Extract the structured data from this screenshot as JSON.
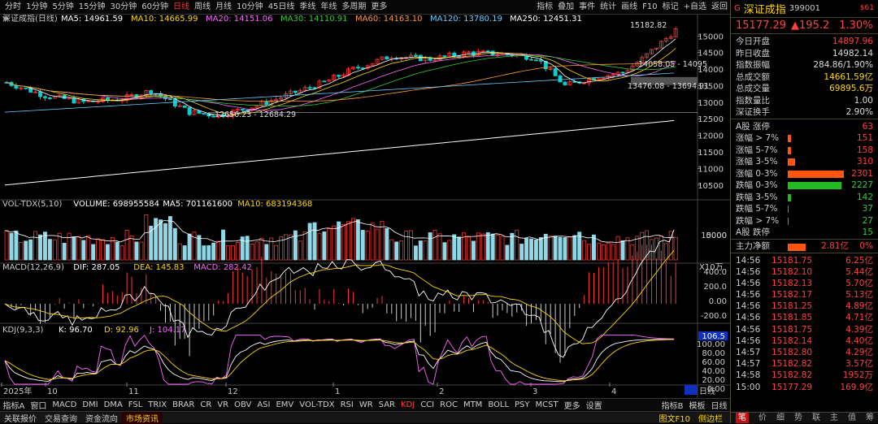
{
  "periods": [
    "分时",
    "1分钟",
    "5分钟",
    "15分钟",
    "30分钟",
    "60分钟",
    "日线",
    "周线",
    "月线",
    "10分钟",
    "45日线",
    "季线",
    "年线",
    "多周期",
    "更多"
  ],
  "active_period": "日线",
  "toolbar_right": [
    "指标",
    "叠加",
    "事件",
    "统计",
    "画线",
    "F10",
    "标记",
    "+自选",
    "返回"
  ],
  "ma_legend": {
    "title": "深证成指(日线)",
    "items": [
      {
        "t": "MA5: 14961.59",
        "c": "#ffffff"
      },
      {
        "t": "MA10: 14665.99",
        "c": "#ffd700"
      },
      {
        "t": "MA20: 14151.06",
        "c": "#ff66ff"
      },
      {
        "t": "MA30: 14110.91",
        "c": "#33cc33"
      },
      {
        "t": "MA60: 14163.10",
        "c": "#ff9933"
      },
      {
        "t": "MA120: 13780.19",
        "c": "#66ccff"
      },
      {
        "t": "MA250: 12451.31",
        "c": "#ffffff"
      }
    ]
  },
  "vol_legend": {
    "title": "VOL-TDX(5,10)",
    "items": [
      {
        "t": "VOLUME: 698955584",
        "c": "#ffffff"
      },
      {
        "t": "MA5: 701161600",
        "c": "#ffffff"
      },
      {
        "t": "MA10: 683194368",
        "c": "#ffd700"
      }
    ]
  },
  "macd_legend": {
    "title": "MACD(12,26,9)",
    "items": [
      {
        "t": "DIF: 287.05",
        "c": "#ffffff"
      },
      {
        "t": "DEA: 145.83",
        "c": "#ffd700"
      },
      {
        "t": "MACD: 282.42",
        "c": "#ff66ff"
      }
    ]
  },
  "kdj_legend": {
    "title": "KDJ(9,3,3)",
    "items": [
      {
        "t": "K: 96.70",
        "c": "#ffffff"
      },
      {
        "t": "D: 92.96",
        "c": "#ffd700"
      },
      {
        "t": "J: 104.17",
        "c": "#ff66ff"
      }
    ]
  },
  "price_axis": [
    "15000",
    "14500",
    "14000",
    "13500",
    "13000",
    "12500",
    "12000",
    "11500",
    "11000",
    "10500"
  ],
  "vol_axis": [
    "10000",
    "5000"
  ],
  "vol_unit": "X10万",
  "macd_axis": [
    "400.0",
    "200.0",
    "0.00",
    "-200.0"
  ],
  "kdj_axis": [
    "106.5",
    "100.00",
    "80.00",
    "60.00",
    "40.00",
    "20.00",
    "0.00"
  ],
  "annotations": {
    "high": "15182.82",
    "low1": "12684.29",
    "low1b": "12656.23",
    "low1c": "12564.92",
    "mid": "14058.05 - 14095",
    "low2": "13476.08 - 13694.91"
  },
  "date_labels": [
    "2025年",
    "10",
    "11",
    "12",
    "1",
    "2",
    "3",
    "4"
  ],
  "chart_data": {
    "type": "candlestick",
    "title": "深证成指(日线)",
    "y_range": [
      10200,
      15400
    ],
    "last_close": 15177.29,
    "high": 15182.82,
    "moving_averages": {
      "MA5": 14961.59,
      "MA10": 14665.99,
      "MA20": 14151.06,
      "MA30": 14110.91,
      "MA60": 14163.1,
      "MA120": 13780.19,
      "MA250": 12451.31
    },
    "volume": 698955584,
    "vol_ma5": 701161600,
    "vol_ma10": 683194368,
    "macd": {
      "DIF": 287.05,
      "DEA": 145.83,
      "MACD": 282.42
    },
    "kdj": {
      "K": 96.7,
      "D": 92.96,
      "J": 104.17
    }
  },
  "quote": {
    "name": "深证成指",
    "code": "399001",
    "badge": "$61",
    "price": "15177.29",
    "change": "▲195.2",
    "pct": "1.30%"
  },
  "stats": [
    {
      "l": "今日开盘",
      "v": "14897.96",
      "c": "red"
    },
    {
      "l": "昨日收盘",
      "v": "14982.14",
      "c": "wht"
    },
    {
      "l": "指数振幅",
      "v": "284.86/1.90%",
      "c": "wht"
    },
    {
      "l": "总成交额",
      "v": "14661.59亿",
      "c": "yel"
    },
    {
      "l": "总成交量",
      "v": "69895.6万",
      "c": "yel"
    },
    {
      "l": "指数量比",
      "v": "1.00",
      "c": "wht"
    },
    {
      "l": "深证换手",
      "v": "2.90%",
      "c": "wht"
    }
  ],
  "breadth": [
    {
      "l": "A股 涨停",
      "v": "63",
      "c": "red",
      "w": 0
    },
    {
      "l": "涨幅 > 7%",
      "v": "151",
      "c": "red",
      "w": 3
    },
    {
      "l": "涨幅 5-7%",
      "v": "158",
      "c": "red",
      "w": 3
    },
    {
      "l": "涨幅 3-5%",
      "v": "310",
      "c": "red",
      "w": 7
    },
    {
      "l": "涨幅 0-3%",
      "v": "2301",
      "c": "red",
      "w": 53
    },
    {
      "l": "跌幅 0-3%",
      "v": "2227",
      "c": "grn",
      "w": 51
    },
    {
      "l": "跌幅 3-5%",
      "v": "142",
      "c": "grn",
      "w": 3
    },
    {
      "l": "跌幅 5-7%",
      "v": "37",
      "c": "grn",
      "w": 1
    },
    {
      "l": "跌幅 > 7%",
      "v": "27",
      "c": "grn",
      "w": 1
    },
    {
      "l": "A股 跌停",
      "v": "15",
      "c": "grn",
      "w": 0
    }
  ],
  "net_flow": {
    "l": "主力净额",
    "v": "2.81亿",
    "pct": "0%"
  },
  "ticks": [
    [
      "14:56",
      "15181.75",
      "6.25亿"
    ],
    [
      "14:56",
      "15182.10",
      "5.44亿"
    ],
    [
      "14:56",
      "15182.13",
      "5.70亿"
    ],
    [
      "14:56",
      "15182.17",
      "5.13亿"
    ],
    [
      "14:56",
      "15181.25",
      "4.89亿"
    ],
    [
      "14:56",
      "15181.85",
      "4.71亿"
    ],
    [
      "14:56",
      "15181.75",
      "4.39亿"
    ],
    [
      "14:56",
      "15182.14",
      "4.40亿"
    ],
    [
      "14:57",
      "15182.80",
      "4.29亿"
    ],
    [
      "14:57",
      "15182.82",
      "3.57亿"
    ],
    [
      "14:58",
      "15182.82",
      "1952万"
    ],
    [
      "15:00",
      "15177.29",
      "169.9亿"
    ]
  ],
  "side_tabs": [
    "笔",
    "价",
    "细",
    "势",
    "联",
    "主",
    "值",
    "筹"
  ],
  "indicator_tabs": [
    "指标A",
    "窗口",
    "MACD",
    "DMI",
    "DMA",
    "FSL",
    "TRIX",
    "BRAR",
    "CR",
    "VR",
    "OBV",
    "ASI",
    "EMV",
    "VOL-TDX",
    "RSI",
    "WR",
    "SAR",
    "KDJ",
    "CCI",
    "ROC",
    "MTM",
    "BOLL",
    "PSY",
    "MCST",
    "更多",
    "设置"
  ],
  "active_indicator": "KDJ",
  "tabs_right": [
    "指标B",
    "模板",
    "日线"
  ],
  "status_left": [
    "关联报价",
    "交易查询",
    "资金流向",
    "市场资讯"
  ],
  "status_right": [
    "图文F10",
    "侧边栏"
  ]
}
